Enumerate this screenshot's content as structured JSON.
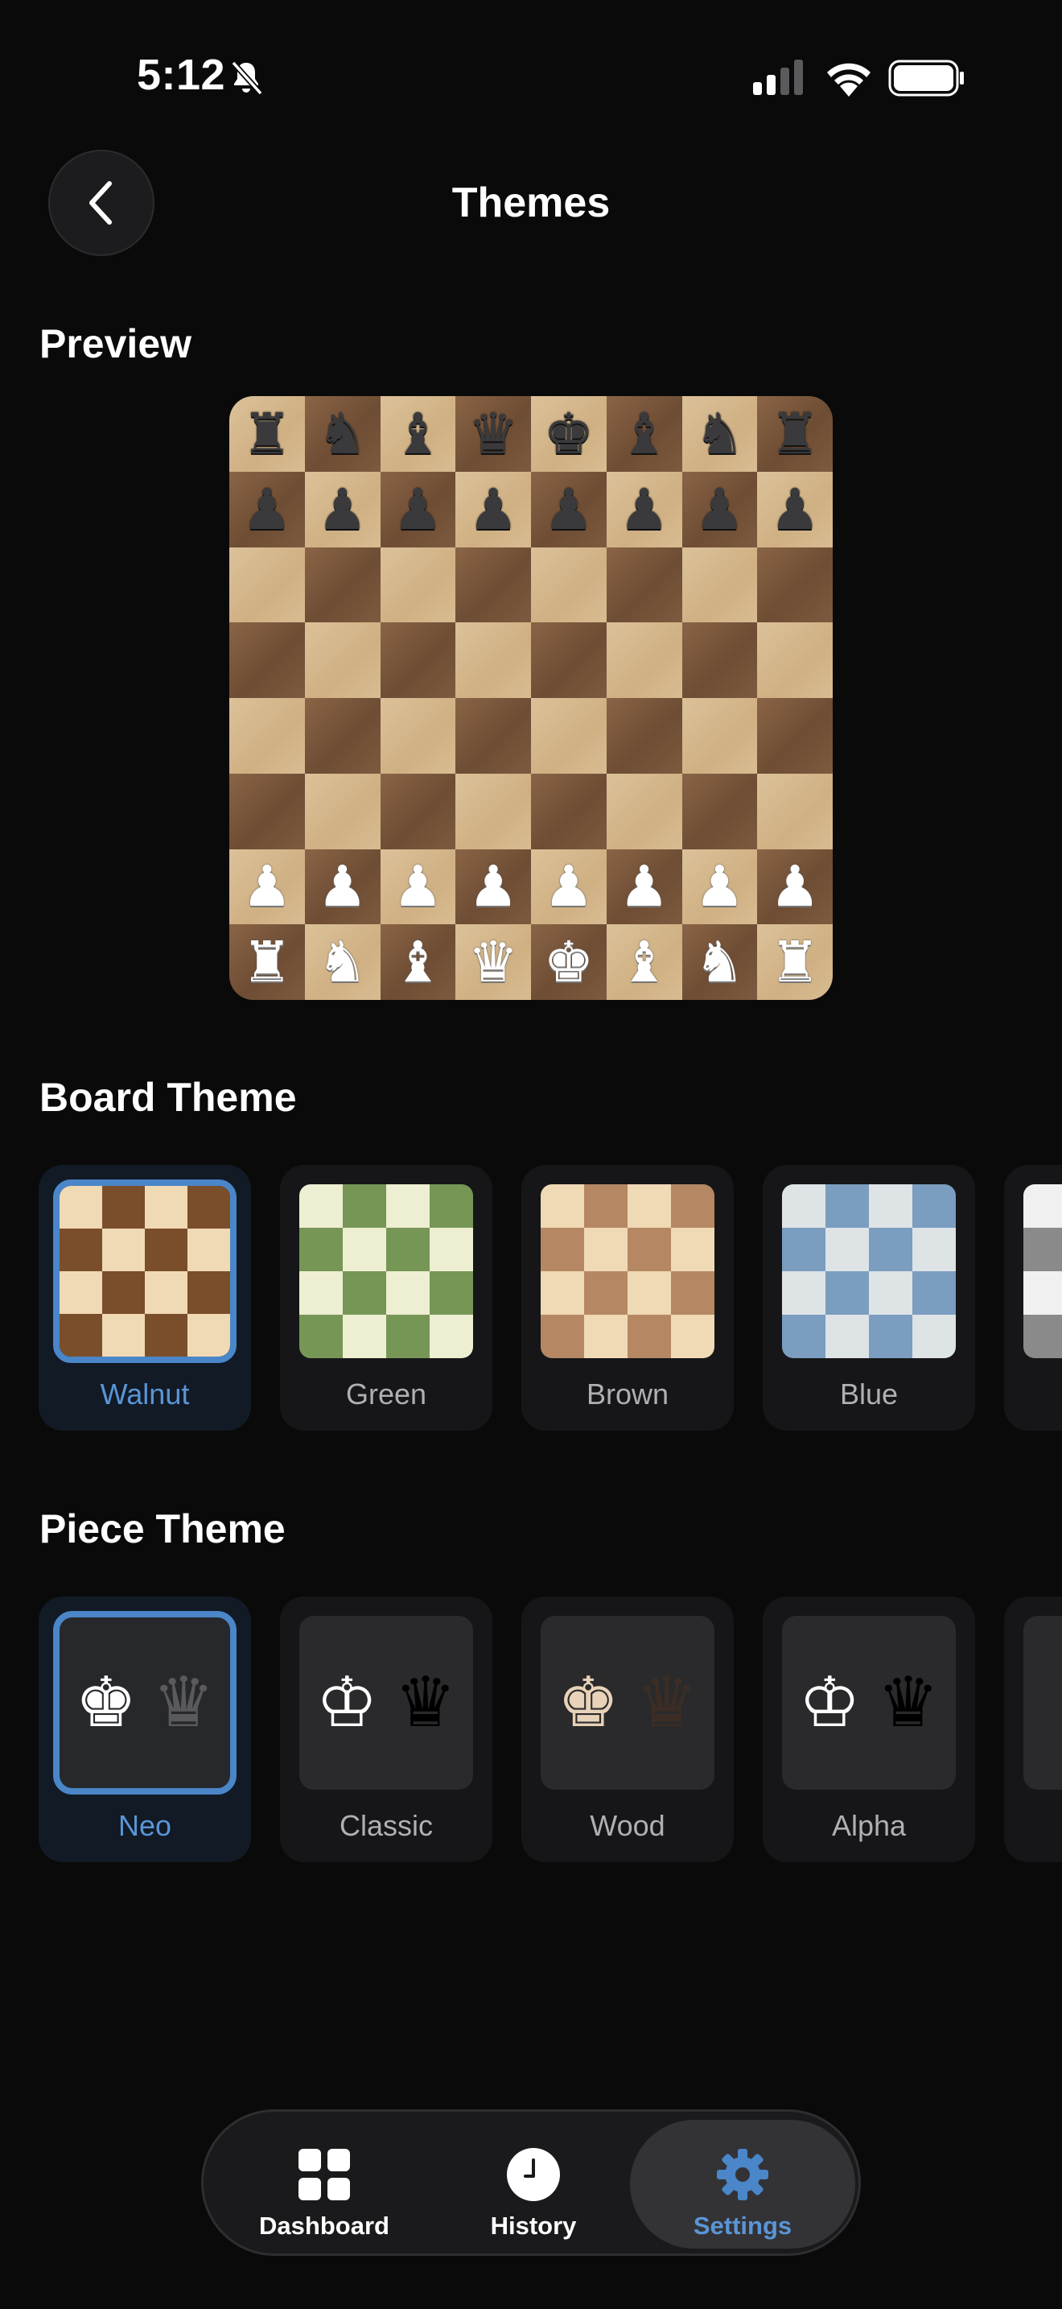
{
  "status_bar": {
    "time": "5:12"
  },
  "header": {
    "title": "Themes"
  },
  "sections": {
    "preview": "Preview",
    "board_theme": "Board Theme",
    "piece_theme": "Piece Theme"
  },
  "preview": {
    "rows": [
      [
        "♜",
        "♞",
        "♝",
        "♛",
        "♚",
        "♝",
        "♞",
        "♜"
      ],
      [
        "♟",
        "♟",
        "♟",
        "♟",
        "♟",
        "♟",
        "♟",
        "♟"
      ],
      [
        "",
        "",
        "",
        "",
        "",
        "",
        "",
        ""
      ],
      [
        "",
        "",
        "",
        "",
        "",
        "",
        "",
        ""
      ],
      [
        "",
        "",
        "",
        "",
        "",
        "",
        "",
        ""
      ],
      [
        "",
        "",
        "",
        "",
        "",
        "",
        "",
        ""
      ],
      [
        "♟",
        "♟",
        "♟",
        "♟",
        "♟",
        "♟",
        "♟",
        "♟"
      ],
      [
        "♜",
        "♞",
        "♝",
        "♛",
        "♚",
        "♝",
        "♞",
        "♜"
      ]
    ]
  },
  "board_themes": [
    {
      "label": "Walnut",
      "light": "#f0d9b5",
      "dark": "#7b4e2b",
      "selected": true
    },
    {
      "label": "Green",
      "light": "#eeeed2",
      "dark": "#769656",
      "selected": false
    },
    {
      "label": "Brown",
      "light": "#f0d9b5",
      "dark": "#b58863",
      "selected": false
    },
    {
      "label": "Blue",
      "light": "#dee3e6",
      "dark": "#7b9dbf",
      "selected": false
    },
    {
      "label": "",
      "light": "#f0f0f0",
      "dark": "#8a8a8a",
      "selected": false
    }
  ],
  "piece_themes": [
    {
      "label": "Neo",
      "king": "♚",
      "queen": "♛",
      "king_color": "#ffffff",
      "queen_color": "#5a5a5c",
      "selected": true
    },
    {
      "label": "Classic",
      "king": "♔",
      "queen": "♛",
      "king_color": "#ffffff",
      "queen_color": "#000000",
      "selected": false
    },
    {
      "label": "Wood",
      "king": "♚",
      "queen": "♛",
      "king_color": "#e8d2b8",
      "queen_color": "#3b2d25",
      "selected": false
    },
    {
      "label": "Alpha",
      "king": "♔",
      "queen": "♛",
      "king_color": "#ffffff",
      "queen_color": "#000000",
      "selected": false
    },
    {
      "label": "",
      "king": "♔",
      "queen": "",
      "king_color": "#ffffff",
      "queen_color": "#000000",
      "selected": false
    }
  ],
  "nav": {
    "items": [
      {
        "label": "Dashboard",
        "icon": "grid-icon",
        "active": false
      },
      {
        "label": "History",
        "icon": "clock-icon",
        "active": false
      },
      {
        "label": "Settings",
        "icon": "gear-icon",
        "active": true
      }
    ]
  },
  "colors": {
    "accent": "#4a86c8",
    "accent_text": "#5a95d6",
    "background": "#0a0a0a"
  }
}
